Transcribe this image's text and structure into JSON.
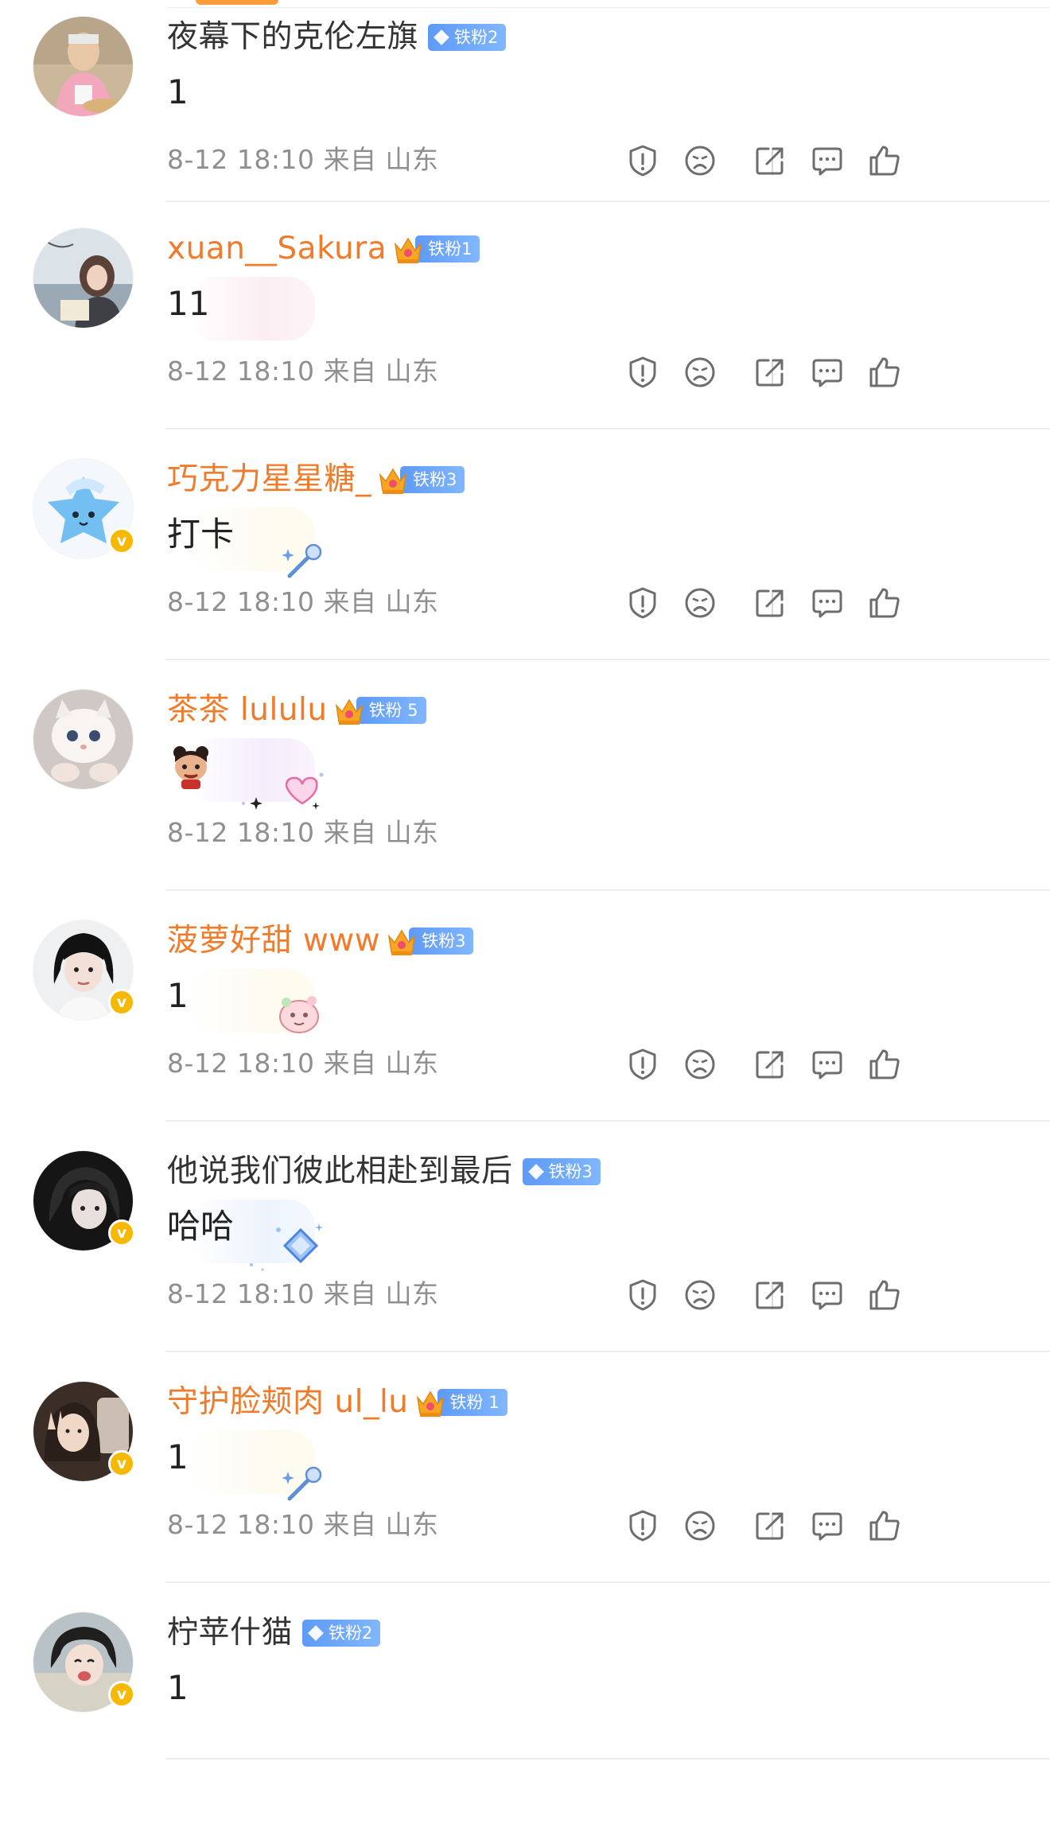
{
  "colors": {
    "vip_name": "#f07b2a",
    "normal_name": "#333333",
    "meta": "#8f8f8f",
    "badge": "#5e9af5",
    "verified": "#f6b800"
  },
  "action_icons": [
    "report-icon",
    "dislike-icon",
    "share-icon",
    "reply-icon",
    "like-icon"
  ],
  "comments": [
    {
      "username": "夜幕下的克伦左旗",
      "vip": false,
      "fan_badge": "铁粉2",
      "text": "1",
      "timestamp": "8-12 18:10",
      "location": "来自 山东",
      "verified": false,
      "bubble": "none"
    },
    {
      "username": "xuan__Sakura",
      "vip": true,
      "fan_badge": "铁粉1",
      "text": "11",
      "timestamp": "8-12 18:10",
      "location": "来自 山东",
      "verified": false,
      "bubble": "pink"
    },
    {
      "username": "巧克力星星糖_",
      "vip": true,
      "fan_badge": "铁粉3",
      "text": "打卡",
      "timestamp": "8-12 18:10",
      "location": "来自 山东",
      "verified": true,
      "bubble": "cream"
    },
    {
      "username": "茶茶 lululu",
      "vip": true,
      "fan_badge": "铁粉 5",
      "text": "",
      "timestamp": "8-12 18:10",
      "location": "来自 山东",
      "verified": false,
      "bubble": "lav"
    },
    {
      "username": "菠萝好甜 www",
      "vip": true,
      "fan_badge": "铁粉3",
      "text": "1",
      "timestamp": "8-12 18:10",
      "location": "来自 山东",
      "verified": true,
      "bubble": "cream"
    },
    {
      "username": "他说我们彼此相赴到最后",
      "vip": false,
      "fan_badge": "铁粉3",
      "text": "哈哈",
      "timestamp": "8-12 18:10",
      "location": "来自 山东",
      "verified": true,
      "bubble": "blue"
    },
    {
      "username": "守护脸颊肉 ul_lu",
      "vip": true,
      "fan_badge": "铁粉 1",
      "text": "1",
      "timestamp": "8-12 18:10",
      "location": "来自 山东",
      "verified": true,
      "bubble": "cream"
    },
    {
      "username": "柠苹什猫",
      "vip": false,
      "fan_badge": "铁粉2",
      "text": "1",
      "timestamp": "",
      "location": "",
      "verified": true,
      "bubble": "none"
    }
  ]
}
